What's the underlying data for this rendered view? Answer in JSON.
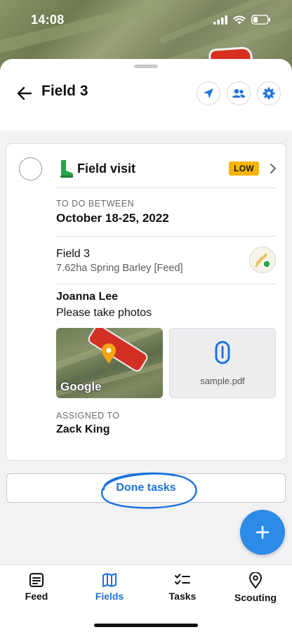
{
  "status_bar": {
    "time": "14:08"
  },
  "header": {
    "title": "Field 3",
    "actions": [
      {
        "name": "navigate-icon"
      },
      {
        "name": "people-icon"
      },
      {
        "name": "gear-icon"
      }
    ]
  },
  "task": {
    "title": "Field visit",
    "priority": "LOW",
    "date_label": "TO DO BETWEEN",
    "date_range": "October 18-25, 2022",
    "field_name": "Field 3",
    "field_meta": "7.62ha Spring Barley [Feed]",
    "author": "Joanna Lee",
    "note": "Please take photos",
    "map_attribution": "Google",
    "attachment_name": "sample.pdf",
    "assigned_label": "ASSIGNED TO",
    "assignee": "Zack King"
  },
  "done_tasks_label": "Done tasks",
  "nav": {
    "items": [
      {
        "label": "Feed",
        "icon": "feed-icon"
      },
      {
        "label": "Fields",
        "icon": "map-icon",
        "active": true
      },
      {
        "label": "Tasks",
        "icon": "checklist-icon"
      },
      {
        "label": "Scouting",
        "icon": "location-pin-icon"
      }
    ]
  },
  "colors": {
    "accent": "#1d72dc",
    "priority_low": "#f6b400",
    "fab": "#2b8be6"
  }
}
